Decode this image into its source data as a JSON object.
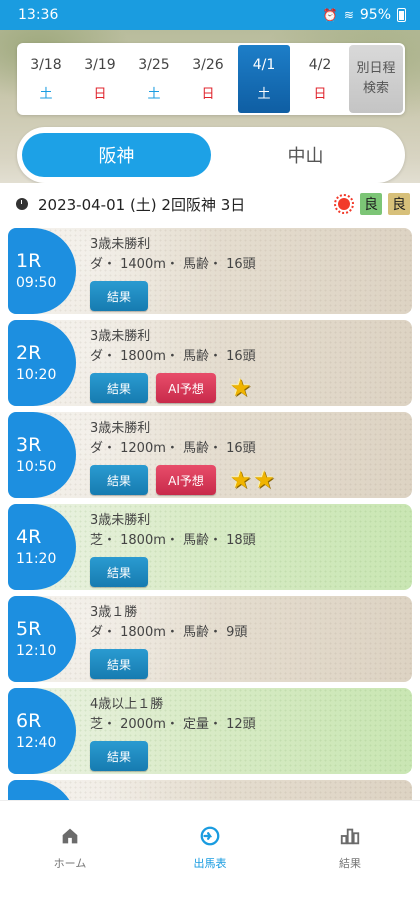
{
  "status_bar": {
    "time": "13:36",
    "battery": "95%"
  },
  "dates": [
    {
      "date": "3/18",
      "dow": "土",
      "type": "sat"
    },
    {
      "date": "3/19",
      "dow": "日",
      "type": "hol"
    },
    {
      "date": "3/25",
      "dow": "土",
      "type": "sat"
    },
    {
      "date": "3/26",
      "dow": "日",
      "type": "hol"
    },
    {
      "date": "4/1",
      "dow": "土",
      "type": "sat"
    },
    {
      "date": "4/2",
      "dow": "日",
      "type": "hol"
    }
  ],
  "other_date_button": "別日程\n検索",
  "venues": [
    "阪神",
    "中山"
  ],
  "race_info": "2023-04-01 (土) 2回阪神 3日",
  "track_conditions": {
    "turf": "良",
    "dirt": "良"
  },
  "races": [
    {
      "no": "1R",
      "time": "09:50",
      "name": "3歳未勝利",
      "detail": "ダ・ 1400m・ 馬齢・ 16頭",
      "surface": "dirt",
      "result_label": "結果",
      "ai_label": "",
      "stars": 0
    },
    {
      "no": "2R",
      "time": "10:20",
      "name": "3歳未勝利",
      "detail": "ダ・ 1800m・ 馬齢・ 16頭",
      "surface": "dirt",
      "result_label": "結果",
      "ai_label": "AI予想",
      "stars": 1
    },
    {
      "no": "3R",
      "time": "10:50",
      "name": "3歳未勝利",
      "detail": "ダ・ 1200m・ 馬齢・ 16頭",
      "surface": "dirt",
      "result_label": "結果",
      "ai_label": "AI予想",
      "stars": 2
    },
    {
      "no": "4R",
      "time": "11:20",
      "name": "3歳未勝利",
      "detail": "芝・ 1800m・ 馬齢・ 18頭",
      "surface": "turf",
      "result_label": "結果",
      "ai_label": "",
      "stars": 0
    },
    {
      "no": "5R",
      "time": "12:10",
      "name": "3歳１勝",
      "detail": "ダ・ 1800m・ 馬齢・ 9頭",
      "surface": "dirt",
      "result_label": "結果",
      "ai_label": "",
      "stars": 0
    },
    {
      "no": "6R",
      "time": "12:40",
      "name": "4歳以上１勝",
      "detail": "芝・ 2000m・ 定量・ 12頭",
      "surface": "turf",
      "result_label": "結果",
      "ai_label": "",
      "stars": 0
    }
  ],
  "bottom_nav": [
    {
      "label": "ホーム",
      "icon": "home-icon"
    },
    {
      "label": "出馬表",
      "icon": "entry-table-icon"
    },
    {
      "label": "結果",
      "icon": "results-chart-icon"
    }
  ]
}
